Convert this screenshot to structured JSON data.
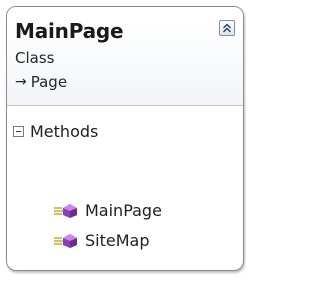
{
  "class_shape": {
    "name": "MainPage",
    "stereotype": "Class",
    "base_type_arrow": "→",
    "base_type": "Page",
    "collapse_icon": "double-chevron-up-icon"
  },
  "compartments": [
    {
      "title": "Methods",
      "toggle_icon": "collapse-minus-icon",
      "members": [
        {
          "name": "MainPage",
          "icon": "method-icon"
        },
        {
          "name": "SiteMap",
          "icon": "method-icon"
        }
      ]
    }
  ],
  "colors": {
    "method_icon_purple": "#8a3fb6",
    "method_icon_lines": "#c8b436",
    "border": "#8c8c8c"
  }
}
